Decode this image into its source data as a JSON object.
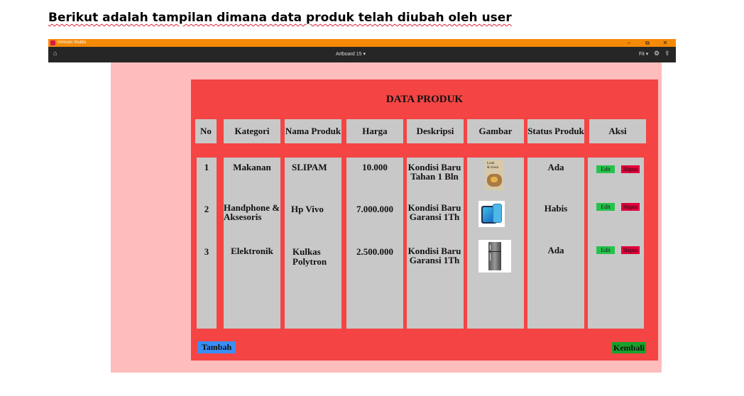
{
  "document": {
    "heading": "Berikut adalah tampilan dimana data produk telah diubah oleh user"
  },
  "window": {
    "app_name": "InVision Studio",
    "artboard_label": "Artboard 15 ▾",
    "zoom_label": "Fit ▾",
    "controls": {
      "minimize": "–",
      "restore": "⧉",
      "close": "✕"
    },
    "toolbar_icons": [
      "home-icon",
      "gear-icon",
      "share-icon"
    ]
  },
  "page": {
    "title": "DATA PRODUK",
    "headers": [
      "No",
      "Kategori",
      "Nama Produk",
      "Harga",
      "Deskripsi",
      "Gambar",
      "Status Produk",
      "Aksi"
    ],
    "rows": [
      {
        "no": "1",
        "kategori": [
          "Makanan"
        ],
        "nama": [
          "SLIPAM"
        ],
        "harga": "10.000",
        "deskripsi": [
          "Kondisi Baru",
          "Tahan 1 Bln"
        ],
        "gambar": "book-cover-thumbnail",
        "gambar_text": [
          "Look",
          "& Scent"
        ],
        "status": "Ada",
        "edit_label": "Edit",
        "hapus_label": "Hapus"
      },
      {
        "no": "2",
        "kategori": [
          "Handphone &",
          "Aksesoris"
        ],
        "nama": [
          "Hp Vivo"
        ],
        "harga": "7.000.000",
        "deskripsi": [
          "Kondisi Baru",
          "Garansi 1Th"
        ],
        "gambar": "phone-thumbnail",
        "status": "Habis",
        "edit_label": "Edit",
        "hapus_label": "Hapus"
      },
      {
        "no": "3",
        "kategori": [
          "Elektronik"
        ],
        "nama": [
          "Kulkas",
          "Polytron"
        ],
        "harga": "2.500.000",
        "deskripsi": [
          "Kondisi Baru",
          "Garansi 1Th"
        ],
        "gambar": "fridge-thumbnail",
        "status": "Ada",
        "edit_label": "Edit",
        "hapus_label": "Hapus"
      }
    ],
    "tambah_label": "Tambah",
    "kembali_label": "Kembali"
  },
  "colors": {
    "titlebar": "#f58a07",
    "toolbar": "#262626",
    "artboard_bg": "#ffbcbc",
    "panel": "#f44444",
    "column": "#c8c8c8",
    "edit": "#27c24c",
    "hapus": "#e0003c",
    "tambah": "#3a8ef5",
    "kembali": "#17a22c"
  }
}
